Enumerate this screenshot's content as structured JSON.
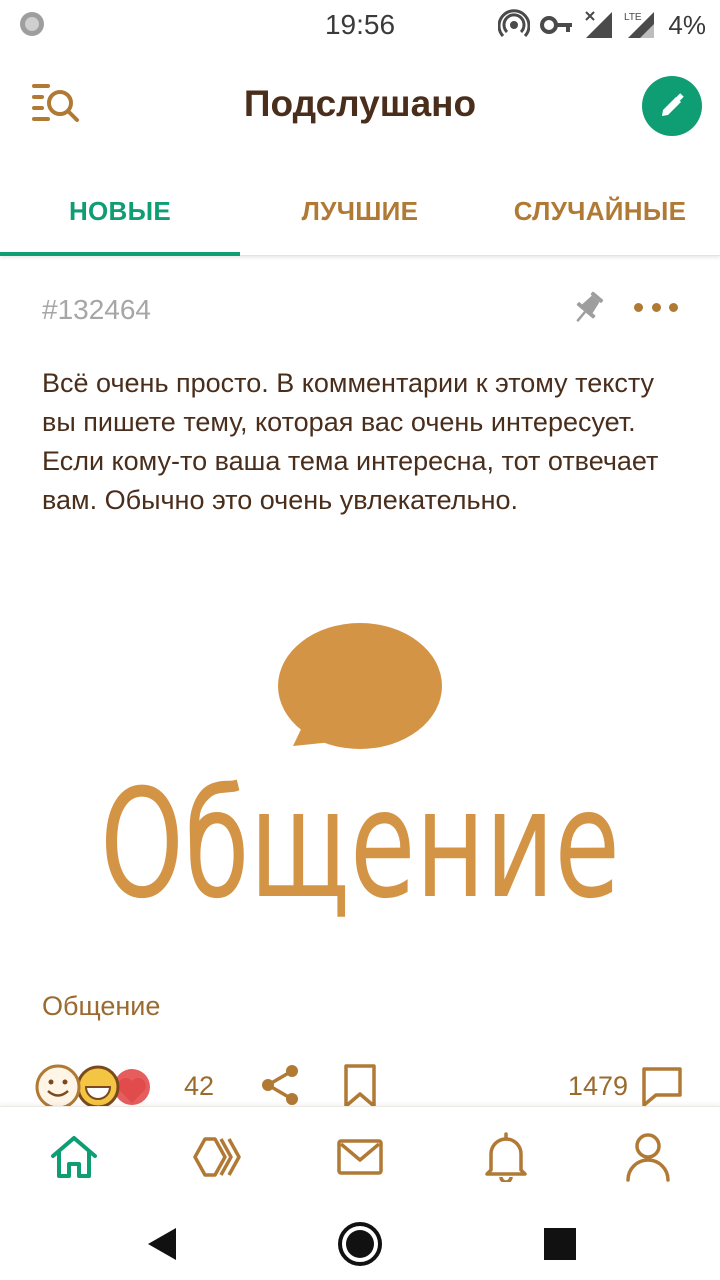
{
  "status_bar": {
    "time": "19:56",
    "battery": "4%",
    "network": "LTE",
    "icons": [
      "loading-icon",
      "hotspot-icon",
      "vpn-key-icon",
      "signal-x-icon",
      "signal-lte-icon"
    ]
  },
  "appbar": {
    "title": "Подслушано",
    "left_icon": "search-list-icon",
    "right_icon": "edit-icon"
  },
  "tabs": [
    {
      "label": "НОВЫЕ",
      "active": true
    },
    {
      "label": "ЛУЧШИЕ",
      "active": false
    },
    {
      "label": "СЛУЧАЙНЫЕ",
      "active": false
    }
  ],
  "post": {
    "id": "#132464",
    "text": "Всё очень просто. В комментарии к этому тексту вы пишете тему, которая вас очень интересует. Если кому-то ваша тема интересна, тот отвечает вам. Обычно это очень увлекательно.",
    "image_word": "Общение",
    "tag": "Общение",
    "likes": "42",
    "comments": "1479"
  },
  "bottom_nav": [
    {
      "name": "home-icon",
      "active": true
    },
    {
      "name": "feed-arrows-icon",
      "active": false
    },
    {
      "name": "mail-icon",
      "active": false
    },
    {
      "name": "bell-icon",
      "active": false
    },
    {
      "name": "profile-icon",
      "active": false
    }
  ],
  "colors": {
    "accent": "#0f9d74",
    "brown": "#b07a35",
    "dark_brown": "#4a2e1c",
    "image_orange": "#d39446"
  }
}
